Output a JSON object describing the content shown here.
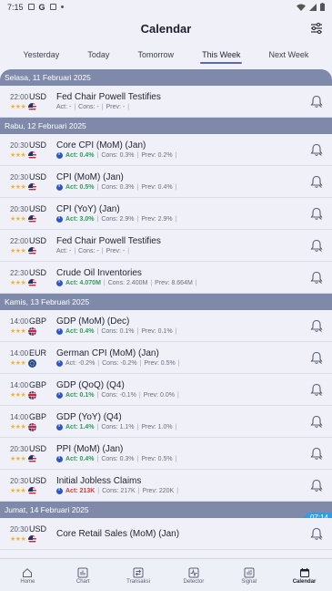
{
  "status": {
    "time": "7:15",
    "g_label": "G"
  },
  "header": {
    "title": "Calendar"
  },
  "tabs": [
    {
      "label": "Yesterday"
    },
    {
      "label": "Today"
    },
    {
      "label": "Tomorrow"
    },
    {
      "label": "This Week",
      "active": true
    },
    {
      "label": "Next Week"
    }
  ],
  "sections": [
    {
      "date": "Selasa, 11 Februari 2025",
      "events": [
        {
          "time": "22:00",
          "currency": "USD",
          "flag": "us",
          "name": "Fed Chair Powell Testifies",
          "actual_label": "Act: -",
          "cons": "Cons: -",
          "prev": "Prev: -",
          "trend": "neu"
        }
      ]
    },
    {
      "date": "Rabu, 12 Februari 2025",
      "events": [
        {
          "time": "20:30",
          "currency": "USD",
          "flag": "us",
          "name": "Core CPI (MoM) (Jan)",
          "actual_label": "Act: 0.4%",
          "cons": "Cons: 0.3%",
          "prev": "Prev: 0.2%",
          "trend": "pos"
        },
        {
          "time": "20:30",
          "currency": "USD",
          "flag": "us",
          "name": "CPI (MoM) (Jan)",
          "actual_label": "Act: 0.5%",
          "cons": "Cons: 0.3%",
          "prev": "Prev: 0.4%",
          "trend": "pos"
        },
        {
          "time": "20:30",
          "currency": "USD",
          "flag": "us",
          "name": "CPI (YoY) (Jan)",
          "actual_label": "Act: 3.0%",
          "cons": "Cons: 2.9%",
          "prev": "Prev: 2.9%",
          "trend": "pos"
        },
        {
          "time": "22:00",
          "currency": "USD",
          "flag": "us",
          "name": "Fed Chair Powell Testifies",
          "actual_label": "Act: -",
          "cons": "Cons: -",
          "prev": "Prev: -",
          "trend": "neu"
        },
        {
          "time": "22:30",
          "currency": "USD",
          "flag": "us",
          "name": "Crude Oil Inventories",
          "actual_label": "Act: 4.070M",
          "cons": "Cons: 2.400M",
          "prev": "Prev: 8.664M",
          "trend": "pos"
        }
      ]
    },
    {
      "date": "Kamis, 13 Februari 2025",
      "events": [
        {
          "time": "14:00",
          "currency": "GBP",
          "flag": "gb",
          "name": "GDP (MoM) (Dec)",
          "actual_label": "Act: 0.4%",
          "cons": "Cons: 0.1%",
          "prev": "Prev: 0.1%",
          "trend": "pos"
        },
        {
          "time": "14:00",
          "currency": "EUR",
          "flag": "eu",
          "name": "German CPI (MoM) (Jan)",
          "actual_label": "Act: -0.2%",
          "cons": "Cons: -0.2%",
          "prev": "Prev: 0.5%",
          "trend": "neu"
        },
        {
          "time": "14:00",
          "currency": "GBP",
          "flag": "gb",
          "name": "GDP (QoQ) (Q4)",
          "actual_label": "Act: 0.1%",
          "cons": "Cons: -0.1%",
          "prev": "Prev: 0.0%",
          "trend": "pos"
        },
        {
          "time": "14:00",
          "currency": "GBP",
          "flag": "gb",
          "name": "GDP (YoY) (Q4)",
          "actual_label": "Act: 1.4%",
          "cons": "Cons: 1.1%",
          "prev": "Prev: 1.0%",
          "trend": "pos"
        },
        {
          "time": "20:30",
          "currency": "USD",
          "flag": "us",
          "name": "PPI (MoM) (Jan)",
          "actual_label": "Act: 0.4%",
          "cons": "Cons: 0.3%",
          "prev": "Prev: 0.5%",
          "trend": "pos"
        },
        {
          "time": "20:30",
          "currency": "USD",
          "flag": "us",
          "name": "Initial Jobless Claims",
          "actual_label": "Act: 213K",
          "cons": "Cons: 217K",
          "prev": "Prev: 220K",
          "trend": "neg"
        }
      ]
    },
    {
      "date": "Jumat, 14 Februari 2025",
      "events": [
        {
          "time": "20:30",
          "currency": "USD",
          "flag": "us",
          "name": "Core Retail Sales (MoM) (Jan)",
          "actual_label": "",
          "cons": "",
          "prev": "",
          "trend": "neu"
        }
      ]
    }
  ],
  "now_badge": "07:14",
  "stars": "★★★",
  "nav": [
    {
      "label": "Home",
      "icon": "home-icon"
    },
    {
      "label": "Chart",
      "icon": "chart-icon"
    },
    {
      "label": "Transaksi",
      "icon": "transaction-icon"
    },
    {
      "label": "Detector",
      "icon": "detector-icon"
    },
    {
      "label": "Signal",
      "icon": "signal-icon"
    },
    {
      "label": "Calendar",
      "icon": "calendar-icon",
      "active": true
    }
  ]
}
